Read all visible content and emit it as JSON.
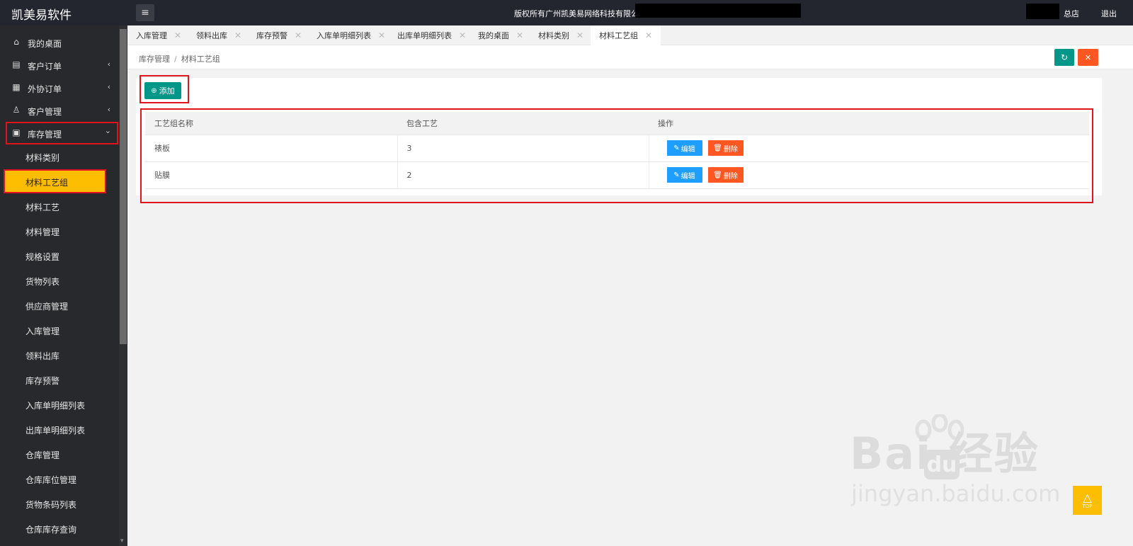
{
  "header": {
    "logo": "凯美易软件",
    "copyright": "版权所有广州凯美易网络科技有限公司",
    "branch": "总店",
    "logout": "退出"
  },
  "sidebar": {
    "items": [
      {
        "label": "我的桌面",
        "icon": "home-icon"
      },
      {
        "label": "客户订单",
        "icon": "order-icon",
        "chevron": "‹"
      },
      {
        "label": "外协订单",
        "icon": "outsource-icon",
        "chevron": "‹"
      },
      {
        "label": "客户管理",
        "icon": "customer-icon",
        "chevron": "‹"
      },
      {
        "label": "库存管理",
        "icon": "inventory-icon",
        "chevron": "⌄"
      }
    ],
    "sub_items": [
      "材料类别",
      "材料工艺组",
      "材料工艺",
      "材料管理",
      "规格设置",
      "货物列表",
      "供应商管理",
      "入库管理",
      "领料出库",
      "库存预警",
      "入库单明细列表",
      "出库单明细列表",
      "仓库管理",
      "仓库库位管理",
      "货物条码列表",
      "仓库库存查询"
    ],
    "active_sub": "材料工艺组"
  },
  "tabs": [
    "入库管理",
    "领料出库",
    "库存预警",
    "入库单明细列表",
    "出库单明细列表",
    "我的桌面",
    "材料类别",
    "材料工艺组"
  ],
  "active_tab": "材料工艺组",
  "breadcrumb": {
    "parent": "库存管理",
    "sep": "/",
    "current": "材料工艺组"
  },
  "toolbar": {
    "add_label": "添加"
  },
  "table": {
    "headers": [
      "工艺组名称",
      "包含工艺",
      "操作"
    ],
    "rows": [
      {
        "name": "裱板",
        "count": "3"
      },
      {
        "name": "贴膜",
        "count": "2"
      }
    ],
    "edit_label": "编辑",
    "delete_label": "删除"
  },
  "watermark": {
    "main": "Bai 经验",
    "sub": "jingyan.baidu.com",
    "du": "du"
  },
  "to_top": "TOP",
  "colors": {
    "teal": "#009688",
    "orange": "#ff5722",
    "blue": "#1e9fff",
    "yellow": "#fdbd00",
    "dark": "#23262e"
  }
}
